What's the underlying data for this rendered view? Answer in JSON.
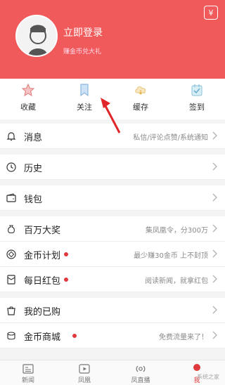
{
  "header": {
    "login_title": "立即登录",
    "login_subtitle": "赚金币兑大礼",
    "coin_icon": "coin-icon"
  },
  "quick_actions": [
    {
      "label": "收藏",
      "icon": "star-icon"
    },
    {
      "label": "关注",
      "icon": "bookmark-icon"
    },
    {
      "label": "缓存",
      "icon": "cloud-icon"
    },
    {
      "label": "签到",
      "icon": "calendar-check-icon"
    }
  ],
  "menu": [
    {
      "label": "消息",
      "right": "私信/评论点赞/系统通知",
      "icon": "bell-icon",
      "dot": false
    },
    {
      "label": "历史",
      "right": "",
      "icon": "clock-icon",
      "dot": false
    },
    {
      "label": "钱包",
      "right": "",
      "icon": "wallet-icon",
      "dot": false
    },
    {
      "label": "百万大奖",
      "right": "集凤凰令，分300万",
      "icon": "moneybag-icon",
      "dot": false
    },
    {
      "label": "金币计划",
      "right": "最少赚30金币 上不封顶",
      "icon": "coin-plan-icon",
      "dot": true
    },
    {
      "label": "每日红包",
      "right": "阅读新闻，就拿红包",
      "icon": "red-envelope-icon",
      "dot": true
    },
    {
      "label": "我的已购",
      "right": "",
      "icon": "shopping-bag-icon",
      "dot": false
    },
    {
      "label": "金币商城",
      "right": "免费流量来了！",
      "icon": "coin-stack-icon",
      "dot": true
    }
  ],
  "bottom_nav": [
    {
      "label": "新闻",
      "icon": "news-icon",
      "active": false
    },
    {
      "label": "凤凰",
      "icon": "play-icon",
      "active": false
    },
    {
      "label": "凤直播",
      "icon": "live-icon",
      "active": false
    },
    {
      "label": "我",
      "icon": "me-icon",
      "active": true
    }
  ],
  "watermark": "系统之家",
  "colors": {
    "brand_red": "#f05a5b",
    "accent_red": "#e03a3e",
    "text_gray": "#8a8a8a"
  }
}
